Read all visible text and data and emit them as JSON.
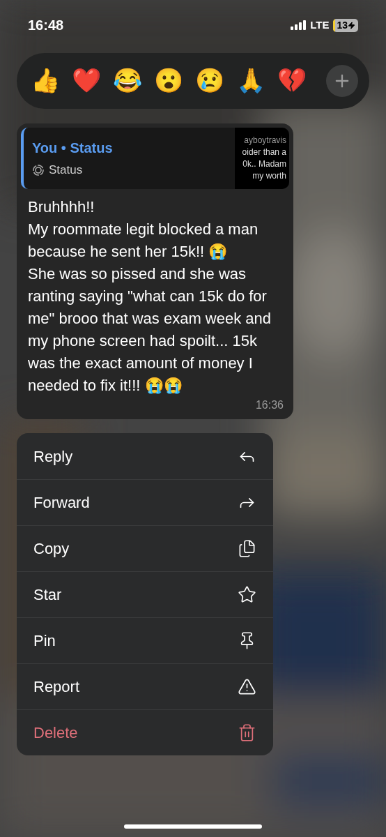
{
  "status_bar": {
    "time": "16:48",
    "network": "LTE",
    "battery": "13"
  },
  "reactions": [
    {
      "emoji": "👍"
    },
    {
      "emoji": "❤️"
    },
    {
      "emoji": "😂"
    },
    {
      "emoji": "😮"
    },
    {
      "emoji": "😢"
    },
    {
      "emoji": "🙏"
    },
    {
      "emoji": "💔"
    }
  ],
  "message": {
    "quote": {
      "title": "You • Status",
      "subtitle": "Status",
      "thumbnail_lines": [
        "ayboytravis",
        "oider than a",
        "0k.. Madam",
        "my worth"
      ]
    },
    "text": "Bruhhhh!!\nMy roommate legit blocked a man because he sent her 15k!! 😭\nShe was so pissed and she was ranting saying \"what can 15k do for me\" brooo that was exam week and my phone screen had spoilt... 15k was the exact amount of money I needed to fix it!!! 😭😭",
    "time": "16:36"
  },
  "menu": [
    {
      "label": "Reply",
      "kind": "normal"
    },
    {
      "label": "Forward",
      "kind": "normal"
    },
    {
      "label": "Copy",
      "kind": "normal"
    },
    {
      "label": "Star",
      "kind": "normal"
    },
    {
      "label": "Pin",
      "kind": "normal"
    },
    {
      "label": "Report",
      "kind": "normal"
    },
    {
      "label": "Delete",
      "kind": "destructive"
    }
  ]
}
